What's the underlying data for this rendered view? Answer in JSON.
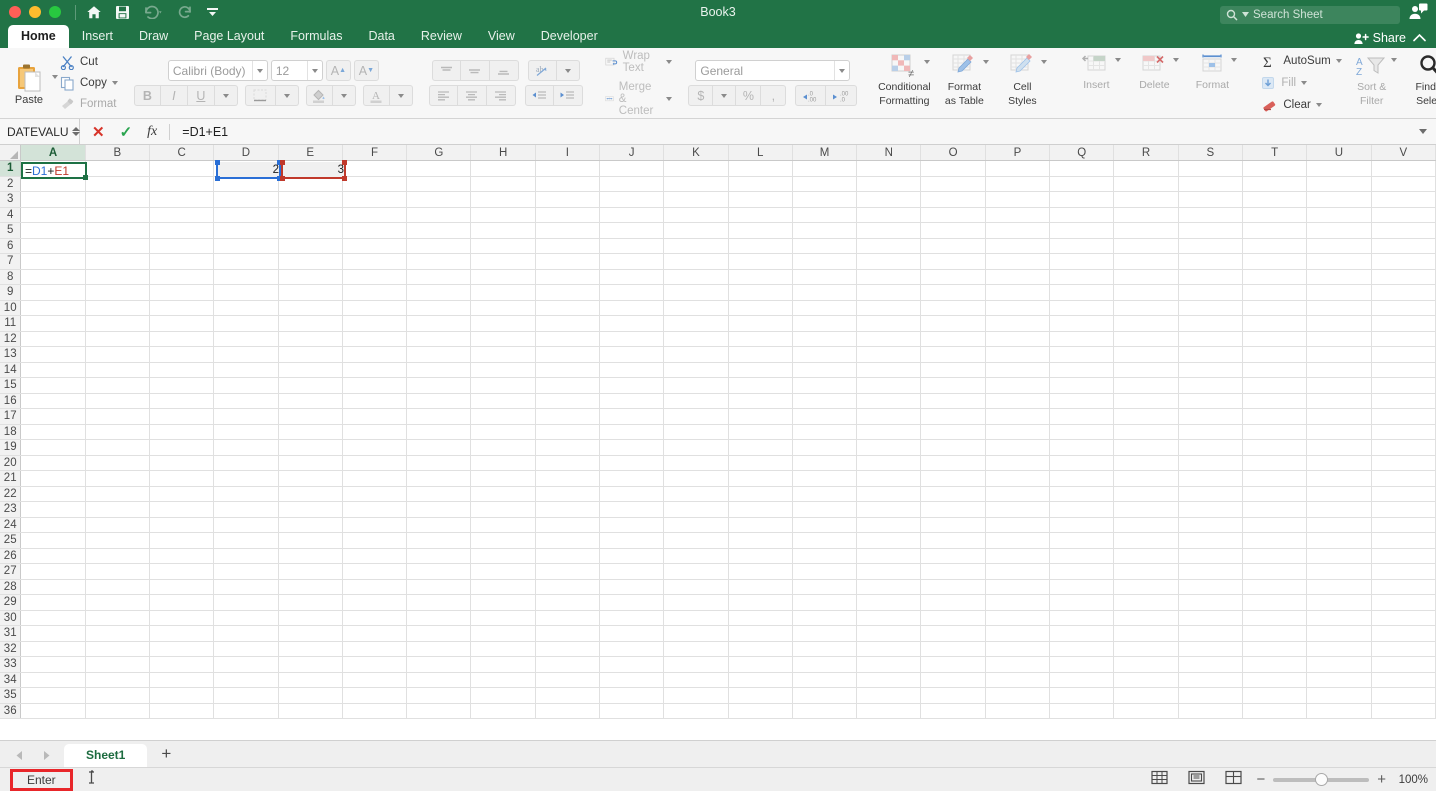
{
  "titlebar": {
    "title": "Book3",
    "quick_access": [
      "home-icon",
      "save-icon",
      "undo-icon",
      "redo-icon",
      "customize-icon"
    ],
    "search_placeholder": "Search Sheet",
    "account_icon": "account-icon"
  },
  "tabs": [
    {
      "label": "Home",
      "active": true
    },
    {
      "label": "Insert",
      "active": false
    },
    {
      "label": "Draw",
      "active": false
    },
    {
      "label": "Page Layout",
      "active": false
    },
    {
      "label": "Formulas",
      "active": false
    },
    {
      "label": "Data",
      "active": false
    },
    {
      "label": "Review",
      "active": false
    },
    {
      "label": "View",
      "active": false
    },
    {
      "label": "Developer",
      "active": false
    }
  ],
  "share": {
    "label": "Share"
  },
  "ribbon": {
    "clipboard": {
      "paste": "Paste",
      "cut": "Cut",
      "copy": "Copy",
      "format_painter": "Format"
    },
    "font": {
      "family": "Calibri (Body)",
      "size": "12",
      "grow": "A",
      "shrink": "A",
      "bold": "B",
      "italic": "I",
      "underline": "U"
    },
    "alignment": {
      "wrap_text": "Wrap Text",
      "merge_center": "Merge & Center"
    },
    "number": {
      "format": "General",
      "currency": "$",
      "percent": "%",
      "comma": ",",
      "increase_decimal": ".00",
      "decrease_decimal": ".0"
    },
    "styles": {
      "conditional_formatting": "Conditional\nFormatting",
      "conditional_formatting_l1": "Conditional",
      "conditional_formatting_l2": "Formatting",
      "format_as_table_l1": "Format",
      "format_as_table_l2": "as Table",
      "cell_styles_l1": "Cell",
      "cell_styles_l2": "Styles"
    },
    "cells": {
      "insert": "Insert",
      "delete": "Delete",
      "format": "Format"
    },
    "editing": {
      "autosum": "AutoSum",
      "fill": "Fill",
      "clear": "Clear",
      "sort_filter_l1": "Sort &",
      "sort_filter_l2": "Filter",
      "find_select_l1": "Find &",
      "find_select_l2": "Select"
    }
  },
  "formula_bar": {
    "name_box": "DATEVALU",
    "cancel_icon": "✕",
    "enter_icon": "✓",
    "fx_icon": "fx",
    "formula": "=D1+E1"
  },
  "grid": {
    "columns": [
      "A",
      "B",
      "C",
      "D",
      "E",
      "F",
      "G",
      "H",
      "I",
      "J",
      "K",
      "L",
      "M",
      "N",
      "O",
      "P",
      "Q",
      "R",
      "S",
      "T",
      "U",
      "V"
    ],
    "rows": [
      1,
      2,
      3,
      4,
      5,
      6,
      7,
      8,
      9,
      10,
      11,
      12,
      13,
      14,
      15,
      16,
      17,
      18,
      19,
      20,
      21,
      22,
      23,
      24,
      25,
      26,
      27,
      28,
      29,
      30,
      31,
      32,
      33,
      34,
      35,
      36
    ],
    "active_cell": "A1",
    "editing_formula": {
      "parts": [
        {
          "text": "=",
          "color": "#1e1e1e"
        },
        {
          "text": "D1",
          "color": "#2a6fd6"
        },
        {
          "text": "+",
          "color": "#1e1e1e"
        },
        {
          "text": "E1",
          "color": "#c0392b"
        }
      ]
    },
    "references": [
      {
        "cell": "D1",
        "value": "2",
        "color": "#2a6fd6"
      },
      {
        "cell": "E1",
        "value": "3",
        "color": "#c0392b"
      }
    ]
  },
  "sheet_tabs": {
    "tabs": [
      {
        "label": "Sheet1",
        "active": true
      }
    ],
    "add_label": "+"
  },
  "status_bar": {
    "mode": "Enter",
    "mode_highlight_color": "#e8262a",
    "zoom": "100%",
    "views": [
      "normal-view-icon",
      "page-layout-icon",
      "page-break-icon"
    ]
  }
}
